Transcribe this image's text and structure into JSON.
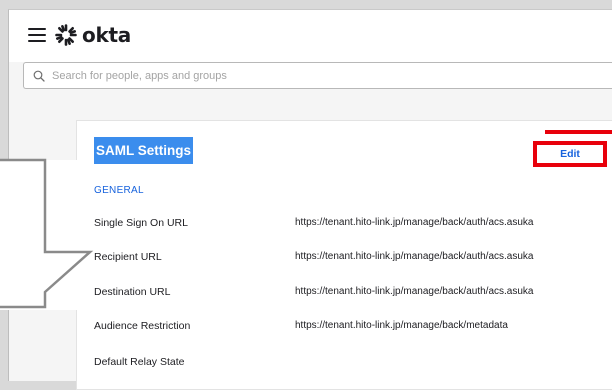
{
  "header": {
    "menu_icon": "hamburger-icon",
    "logo_icon": "okta-sunburst-icon",
    "logo_text": "okta"
  },
  "search": {
    "icon": "search-icon",
    "placeholder": "Search for people, apps and groups",
    "value": ""
  },
  "card": {
    "title": "SAML Settings",
    "edit_label": "Edit",
    "section_label": "GENERAL",
    "rows": [
      {
        "label": "Single Sign On URL",
        "value": "https://tenant.hito-link.jp/manage/back/auth/acs.asuka"
      },
      {
        "label": "Recipient URL",
        "value": "https://tenant.hito-link.jp/manage/back/auth/acs.asuka"
      },
      {
        "label": "Destination URL",
        "value": "https://tenant.hito-link.jp/manage/back/auth/acs.asuka"
      },
      {
        "label": "Audience Restriction",
        "value": "https://tenant.hito-link.jp/manage/back/metadata"
      },
      {
        "label": "Default Relay State",
        "value": ""
      }
    ]
  },
  "annotation_colors": {
    "highlight": "#3b8ded",
    "edit_outline": "#e8000b"
  }
}
